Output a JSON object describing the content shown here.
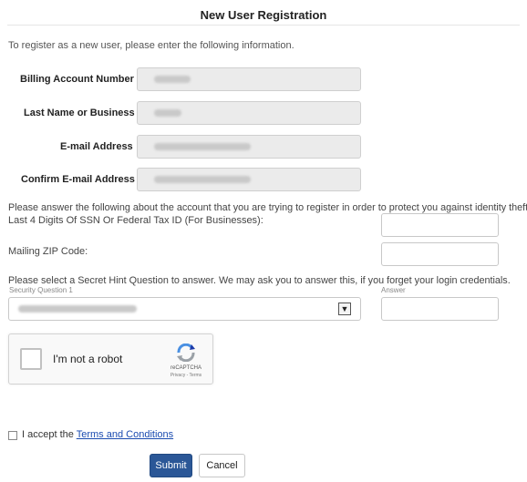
{
  "page": {
    "title": "New User Registration",
    "intro": "To register as a new user, please enter the following information."
  },
  "fields": {
    "billing_account_number": {
      "label": "Billing Account Number"
    },
    "last_name_or_business": {
      "label": "Last Name or Business"
    },
    "email_address": {
      "label": "E-mail Address"
    },
    "confirm_email_address": {
      "label": "Confirm E-mail Address"
    }
  },
  "identity": {
    "instruction": "Please answer the following about the account that you are trying to register in order to protect you against identity theft.",
    "ssn_label": "Last 4 Digits Of SSN Or Federal Tax ID (For Businesses):",
    "zip_label": "Mailing ZIP Code:"
  },
  "security": {
    "instruction": "Please select a Secret Hint Question to answer. We may ask you to answer this, if you forget your login credentials.",
    "question_label": "Security Question 1",
    "answer_label": "Answer"
  },
  "captcha": {
    "label": "I'm not a robot",
    "brand": "reCAPTCHA",
    "links": "Privacy - Terms"
  },
  "terms": {
    "prefix": "I accept the ",
    "link": "Terms and Conditions"
  },
  "buttons": {
    "submit": "Submit",
    "cancel": "Cancel"
  },
  "colors": {
    "primary_button": "#2b5797",
    "link": "#1a4bb0"
  },
  "icons": {
    "dropdown": "chevron-down-icon",
    "captcha": "recaptcha-logo-icon"
  }
}
